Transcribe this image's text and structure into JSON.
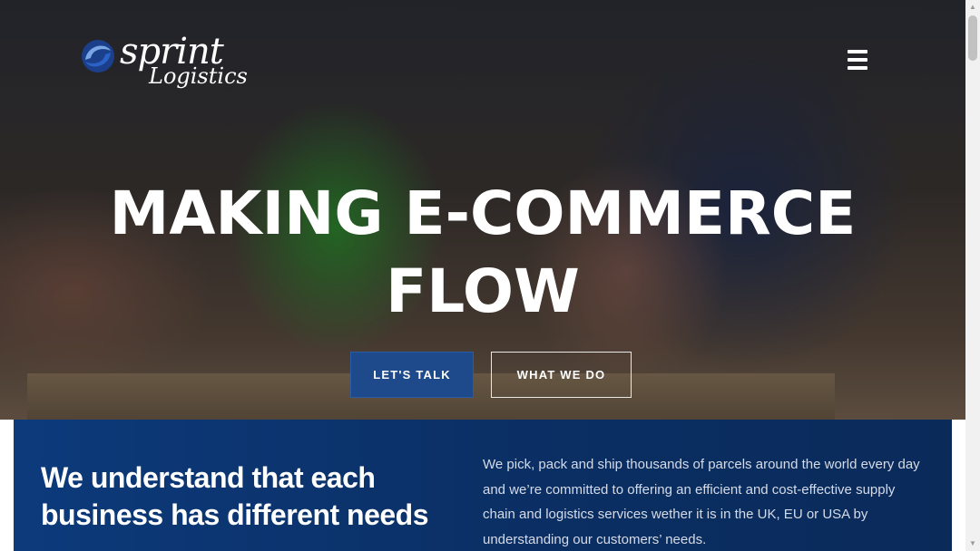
{
  "logo": {
    "line1": "sprint",
    "line2": "Logistics"
  },
  "hero": {
    "title_line1": "MAKING E-COMMERCE",
    "title_line2": "FLOW",
    "primary_button": "LET'S TALK",
    "secondary_button": "WHAT WE DO"
  },
  "menu": {
    "icon": "hamburger-menu-icon"
  },
  "intro": {
    "heading": "We understand that each business has different needs",
    "text": "We pick, pack and ship thousands of parcels around the world every day and we’re committed to offering an efficient and cost-effective supply chain and logistics services wether it is in the UK, EU or USA by understanding our customers’ needs."
  },
  "colors": {
    "brand_blue": "#1e4a8c",
    "panel_blue": "#0c3a7b",
    "text_white": "#ffffff"
  }
}
